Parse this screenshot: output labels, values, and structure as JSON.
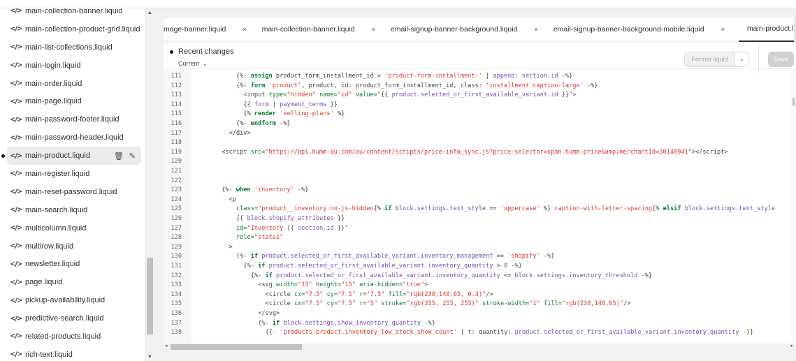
{
  "sidebar": {
    "items": [
      {
        "label": "main-collection-banner.liquid"
      },
      {
        "label": "main-collection-product-grid.liquid"
      },
      {
        "label": "main-list-collections.liquid"
      },
      {
        "label": "main-login.liquid"
      },
      {
        "label": "main-order.liquid"
      },
      {
        "label": "main-page.liquid"
      },
      {
        "label": "main-password-footer.liquid"
      },
      {
        "label": "main-password-header.liquid"
      },
      {
        "label": "main-product.liquid",
        "active": true,
        "modified": true
      },
      {
        "label": "main-register.liquid"
      },
      {
        "label": "main-reset-password.liquid"
      },
      {
        "label": "main-search.liquid"
      },
      {
        "label": "multicolumn.liquid"
      },
      {
        "label": "multirow.liquid"
      },
      {
        "label": "newsletter.liquid"
      },
      {
        "label": "page.liquid"
      },
      {
        "label": "pickup-availability.liquid"
      },
      {
        "label": "predictive-search.liquid"
      },
      {
        "label": "related-products.liquid"
      },
      {
        "label": "rich-text.liquid"
      }
    ],
    "item_icon": "code-icon",
    "item_icon_glyph": "</>",
    "active_actions": {
      "delete_icon": "trash-icon",
      "rename_icon": "pencil-icon",
      "delete_glyph": "🗑",
      "rename_glyph": "✎"
    }
  },
  "tabs": [
    {
      "label": "mage-banner.liquid",
      "close": "×"
    },
    {
      "label": "main-collection-banner.liquid",
      "close": "×"
    },
    {
      "label": "email-signup-banner-background.liquid",
      "close": "×"
    },
    {
      "label": "email-signup-banner-background-mobile.liquid",
      "close": "×"
    },
    {
      "label": "main-product.liquid",
      "active": true
    }
  ],
  "toolbar": {
    "recent_changes_label": "Recent changes",
    "version_select": "Current",
    "format_label": "Format liquid",
    "save_label": "Save"
  },
  "code": {
    "lines": [
      {
        "n": "111",
        "indent": 5,
        "html": "<span class='t'>{%- </span><span class='k'>assign</span><span class='t'> product_form_installment_id = </span><span class='s'>'product-form-installment-'</span><span class='t'> | </span><span class='p'>append</span><span class='t'>: </span><span class='n'>section</span><span class='t'>.</span><span class='n'>id</span><span class='t'> -%}</span>"
      },
      {
        "n": "112",
        "indent": 5,
        "html": "<span class='t'>{%- </span><span class='k'>form</span><span class='t'> </span><span class='s'>'product'</span><span class='t'>, product, id: product_form_installment_id, class: </span><span class='s'>'installment caption-large'</span><span class='t'> -%}</span>"
      },
      {
        "n": "113",
        "indent": 6,
        "html": "<span class='t'>&lt;input </span><span class='g'>type=</span><span class='s'>\"hidden\"</span><span class='t'> </span><span class='g'>name=</span><span class='s'>\"id\"</span><span class='t'> </span><span class='g'>value=</span><span class='s'>\"</span><span class='t'>{{ </span><span class='n'>product.selected_or_first_available_variant.id</span><span class='t'> }}</span><span class='s'>\"</span><span class='t'>&gt;</span>"
      },
      {
        "n": "114",
        "indent": 6,
        "html": "<span class='t'>{{ </span><span class='n'>form</span><span class='t'> | </span><span class='p'>payment_terms</span><span class='t'> }}</span>"
      },
      {
        "n": "115",
        "indent": 6,
        "html": "<span class='t'>{% </span><span class='k'>render</span><span class='t'> </span><span class='s'>'selling-plans'</span><span class='t'> %}</span>"
      },
      {
        "n": "116",
        "indent": 5,
        "html": "<span class='t'>{%- </span><span class='k'>endform</span><span class='t'> -%}</span>"
      },
      {
        "n": "117",
        "indent": 4,
        "html": "<span class='t'>&lt;/div&gt;</span>"
      },
      {
        "n": "118",
        "indent": 0,
        "html": ""
      },
      {
        "n": "119",
        "indent": 3,
        "html": "<span class='t'>&lt;script </span><span class='g'>src=</span><span class='s'>\"https://bpi.humm-au.com/au/content/scripts/price-info_sync.js?price-selector=span.humm-price&amp;amp;merchantId=30140941\"</span><span class='t'>&gt;&lt;/script&gt;</span>"
      },
      {
        "n": "120",
        "indent": 0,
        "html": ""
      },
      {
        "n": "121",
        "indent": 0,
        "html": ""
      },
      {
        "n": "122",
        "indent": 0,
        "html": ""
      },
      {
        "n": "123",
        "indent": 3,
        "html": "<span class='t'>{%- </span><span class='k'>when</span><span class='t'> </span><span class='s'>'inventory'</span><span class='t'> -%}</span>"
      },
      {
        "n": "124",
        "indent": 4,
        "html": "<span class='t'>&lt;p</span>"
      },
      {
        "n": "125",
        "indent": 5,
        "html": "<span class='g'>class=</span><span class='s'>\"product__inventory no-js-hidden</span><span class='t'>{% </span><span class='k'>if</span><span class='t'> </span><span class='n'>block.settings.text_style</span><span class='t'> == </span><span class='s'>'uppercase'</span><span class='t'> %}</span><span class='s'> caption-with-letter-spacing</span><span class='t'>{% </span><span class='k'>elsif</span><span class='t'> </span><span class='n'>block.settings.text_style</span>"
      },
      {
        "n": "126",
        "indent": 5,
        "html": "<span class='t'>{{ </span><span class='n'>block.shopify_attributes</span><span class='t'> }}</span>"
      },
      {
        "n": "127",
        "indent": 5,
        "html": "<span class='g'>id=</span><span class='s'>\"Inventory-</span><span class='t'>{{ </span><span class='n'>section.id</span><span class='t'> }}</span><span class='s'>\"</span>"
      },
      {
        "n": "128",
        "indent": 5,
        "html": "<span class='g'>role=</span><span class='s'>\"status\"</span>"
      },
      {
        "n": "129",
        "indent": 4,
        "html": "<span class='t'>&gt;</span>"
      },
      {
        "n": "130",
        "indent": 5,
        "html": "<span class='t'>{%- </span><span class='k'>if</span><span class='t'> </span><span class='n'>product.selected_or_first_available_variant.inventory_management</span><span class='t'> == </span><span class='s'>'shopify'</span><span class='t'> -%}</span>"
      },
      {
        "n": "131",
        "indent": 6,
        "html": "<span class='t'>{%- </span><span class='k'>if</span><span class='t'> </span><span class='n'>product.selected_or_first_available_variant.inventory_quantity</span><span class='t'> &gt; </span><span class='p'>0</span><span class='t'> -%}</span>"
      },
      {
        "n": "132",
        "indent": 7,
        "html": "<span class='t'>{%- </span><span class='k'>if</span><span class='t'> </span><span class='n'>product.selected_or_first_available_variant.inventory_quantity</span><span class='t'> &lt;= </span><span class='n'>block.settings.inventory_threshold</span><span class='t'> -%}</span>"
      },
      {
        "n": "133",
        "indent": 8,
        "html": "<span class='t'>&lt;svg </span><span class='g'>width=</span><span class='s'>\"15\"</span><span class='t'> </span><span class='g'>height=</span><span class='s'>\"15\"</span><span class='t'> </span><span class='g'>aria-hidden=</span><span class='s'>\"true\"</span><span class='t'>&gt;</span>"
      },
      {
        "n": "134",
        "indent": 9,
        "html": "<span class='t'>&lt;circle </span><span class='g'>cx=</span><span class='s'>\"7.5\"</span><span class='t'> </span><span class='g'>cy=</span><span class='s'>\"7.5\"</span><span class='t'> </span><span class='g'>r=</span><span class='s'>\"7.5\"</span><span class='t'> </span><span class='g'>fill=</span><span class='s'>\"rgb(238,148,65, 0.3)\"</span><span class='t'>/&gt;</span>"
      },
      {
        "n": "135",
        "indent": 9,
        "html": "<span class='t'>&lt;circle </span><span class='g'>cx=</span><span class='s'>\"7.5\"</span><span class='t'> </span><span class='g'>cy=</span><span class='s'>\"7.5\"</span><span class='t'> </span><span class='g'>r=</span><span class='s'>\"5\"</span><span class='t'> </span><span class='g'>stroke=</span><span class='s'>\"rgb(255, 255, 255)\"</span><span class='t'> </span><span class='g'>stroke-width=</span><span class='s'>\"1\"</span><span class='t'> </span><span class='g'>fill=</span><span class='s'>\"rgb(238,148,65)\"</span><span class='t'>/&gt;</span>"
      },
      {
        "n": "136",
        "indent": 8,
        "html": "<span class='t'>&lt;/svg&gt;</span>"
      },
      {
        "n": "137",
        "indent": 8,
        "html": "<span class='t'>{%- </span><span class='k'>if</span><span class='t'> </span><span class='n'>block.settings.show_inventory_quantity</span><span class='t'> -%}</span>"
      },
      {
        "n": "138",
        "indent": 9,
        "html": "<span class='t'>{{- </span><span class='s'>'products.product.inventory_low_stock_show_count'</span><span class='t'> | </span><span class='p'>t</span><span class='t'>: quantity: </span><span class='n'>product.selected_or_first_available_variant.inventory_quantity</span><span class='t'> -}}</span>"
      }
    ],
    "clipped_first_line": "{{ block.shopify_attributes }}"
  },
  "colors": {
    "keyword": "#0a7a2a",
    "string": "#d63a2b",
    "property": "#7a4bb5",
    "save_disabled": "#cfcfcf"
  }
}
